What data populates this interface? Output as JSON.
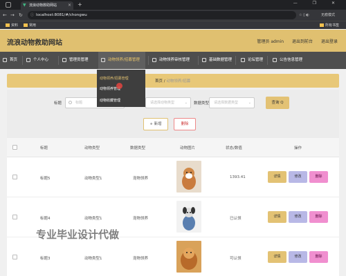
{
  "browser": {
    "tab_title": "流浪动物救助网站",
    "url": "localhost:8081/#/chongwu",
    "new_tab": "+",
    "incognito_label": "无痕模式",
    "bookmarks": [
      "资料",
      "常用"
    ],
    "bookmarks_right": "所有书签",
    "window_controls": "— ❐ ✕"
  },
  "header": {
    "site_title": "流浪动物救助网站",
    "admin_label": "管理员 admin",
    "back_to_front": "退出到前台",
    "logout": "退出登录"
  },
  "nav": {
    "items": [
      {
        "label": "首页"
      },
      {
        "label": "个人中心"
      },
      {
        "label": "管理员管理"
      },
      {
        "label": "动物领养/招募管理"
      },
      {
        "label": "动物领养审核管理"
      },
      {
        "label": "基础数据管理"
      },
      {
        "label": "论坛管理"
      },
      {
        "label": "公告信息管理"
      }
    ]
  },
  "dropdown": {
    "items": [
      "动物领养/招募管理",
      "动物领养管理",
      "动物收藏管理"
    ]
  },
  "breadcrumb": {
    "home": "首页",
    "sep": "/",
    "current": "动物领养/招募"
  },
  "search": {
    "title_label": "标题",
    "title_placeholder": "标题",
    "animal_type_placeholder": "请选择动物类型",
    "data_type_label": "数据类型",
    "data_type_placeholder": "请选择数据类型",
    "query_button": "查询 Q"
  },
  "actions": {
    "add": "+ 新增",
    "delete": "删除"
  },
  "table": {
    "headers": [
      "标题",
      "动物类型",
      "数据类型",
      "动物图片",
      "状态/数值",
      "操作"
    ],
    "rows": [
      {
        "title": "标题5",
        "animal_type": "动物类型1",
        "data_type": "宠物领养",
        "status": "1393.41"
      },
      {
        "title": "标题4",
        "animal_type": "动物类型1",
        "data_type": "宠物领养",
        "status": "已认领"
      },
      {
        "title": "标题3",
        "animal_type": "动物类型1",
        "data_type": "宠物领养",
        "status": "可认领"
      }
    ],
    "row_actions": {
      "detail": "详情",
      "edit": "修改",
      "delete": "删除"
    }
  },
  "watermark": "专业毕业设计代做",
  "colors": {
    "header": "#e0c070",
    "nav": "#4e4e4e",
    "detail_btn": "#e3c274",
    "edit_btn": "#b8b8e6",
    "delete_btn": "#f08fcf"
  }
}
